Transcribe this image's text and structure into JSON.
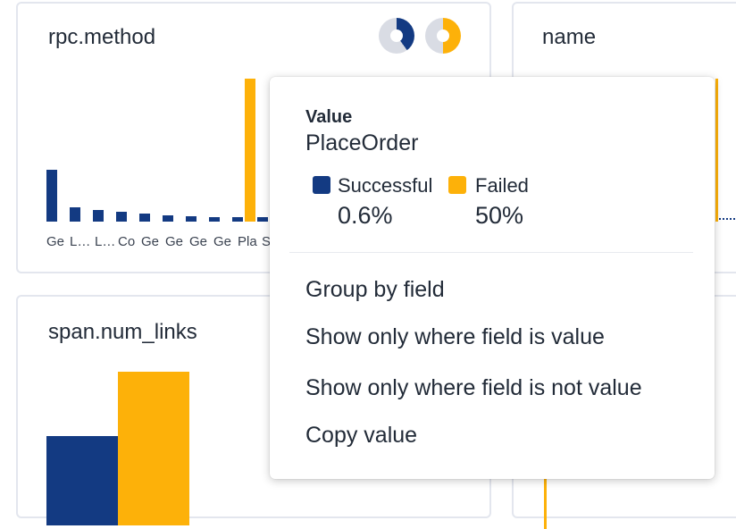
{
  "colors": {
    "successful": "#133a82",
    "failed": "#fdb109",
    "border": "#e3e6ee"
  },
  "card_rpc": {
    "title": "rpc.method",
    "status_pies": [
      {
        "icon": "success-ratio-pie-icon",
        "fraction": 0.4
      },
      {
        "icon": "failure-ratio-pie-icon",
        "fraction": 0.5
      }
    ],
    "tick_labels": [
      "Ge",
      "L…",
      "L…",
      "Co",
      "Ge",
      "Ge",
      "Ge",
      "Ge",
      "Pla",
      "S"
    ]
  },
  "card_name": {
    "title": "name"
  },
  "card_links": {
    "title": "span.num_links"
  },
  "popup": {
    "value_heading": "Value",
    "value": "PlaceOrder",
    "legend": [
      {
        "label": "Successful",
        "percent": "0.6%",
        "color": "#133a82"
      },
      {
        "label": "Failed",
        "percent": "50%",
        "color": "#fdb109"
      }
    ],
    "menu_items": [
      "Group by field",
      "Show only where field is value",
      "Show only where field is not value",
      "Copy value"
    ]
  }
}
